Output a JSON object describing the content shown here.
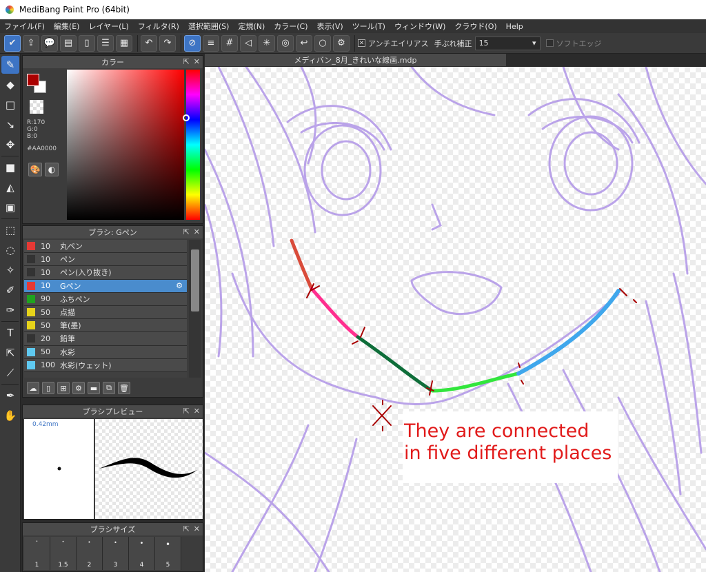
{
  "window": {
    "title": "MediBang Paint Pro (64bit)"
  },
  "menu": [
    "ファイル(F)",
    "編集(E)",
    "レイヤー(L)",
    "フィルタ(R)",
    "選択範囲(S)",
    "定規(N)",
    "カラー(C)",
    "表示(V)",
    "ツール(T)",
    "ウィンドウ(W)",
    "クラウド(O)",
    "Help"
  ],
  "toolbar": {
    "antialias_label": "アンチエイリアス",
    "stabilizer_label": "手ぶれ補正",
    "stabilizer_value": "15",
    "soft_edge_label": "ソフトエッジ"
  },
  "color_panel": {
    "title": "カラー",
    "r": "R:170",
    "g": "G:0",
    "b": "B:0",
    "hex": "#AA0000",
    "fg_color": "#AA0000"
  },
  "brush_panel": {
    "title": "ブラシ: Gペン",
    "brushes": [
      {
        "size": "10",
        "name": "丸ペン",
        "color": "#e53935"
      },
      {
        "size": "10",
        "name": "ペン",
        "color": "#333333"
      },
      {
        "size": "10",
        "name": "ペン(入り抜き)",
        "color": "#333333"
      },
      {
        "size": "10",
        "name": "Gペン",
        "color": "#e53935",
        "selected": true
      },
      {
        "size": "90",
        "name": "ふちペン",
        "color": "#1fa31f"
      },
      {
        "size": "50",
        "name": "点描",
        "color": "#e6d31a"
      },
      {
        "size": "50",
        "name": "筆(墨)",
        "color": "#e6d31a"
      },
      {
        "size": "20",
        "name": "鉛筆",
        "color": "#333333"
      },
      {
        "size": "50",
        "name": "水彩",
        "color": "#5fc9f0"
      },
      {
        "size": "100",
        "name": "水彩(ウェット)",
        "color": "#5fc9f0"
      }
    ]
  },
  "preview_panel": {
    "title": "ブラシプレビュー",
    "size_mm": "0.42mm"
  },
  "size_panel": {
    "title": "ブラシサイズ",
    "sizes": [
      "1",
      "1.5",
      "2",
      "3",
      "4",
      "5"
    ]
  },
  "canvas": {
    "tab_title": "メディバン_8月_きれいな線画.mdp"
  },
  "annotation": {
    "line1": "They are connected",
    "line2": "in five different places"
  }
}
